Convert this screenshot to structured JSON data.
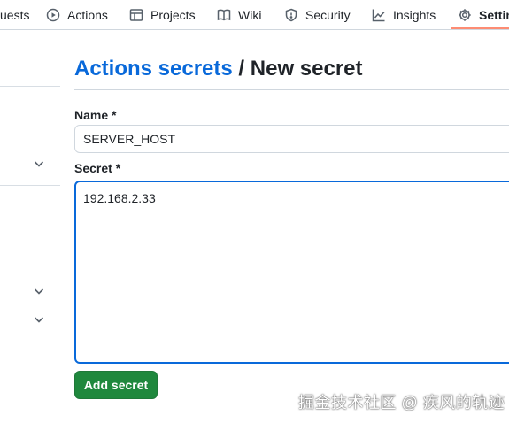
{
  "nav": {
    "tabs": [
      {
        "label": "uests",
        "icon": "pull-request-icon"
      },
      {
        "label": "Actions",
        "icon": "play-icon"
      },
      {
        "label": "Projects",
        "icon": "table-icon"
      },
      {
        "label": "Wiki",
        "icon": "book-icon"
      },
      {
        "label": "Security",
        "icon": "shield-icon"
      },
      {
        "label": "Insights",
        "icon": "graph-icon"
      },
      {
        "label": "Settin",
        "icon": "gear-icon",
        "selected": true
      }
    ]
  },
  "heading": {
    "breadcrumb": "Actions secrets",
    "separator": "/",
    "current": "New secret"
  },
  "form": {
    "name_label": "Name *",
    "name_value": "SERVER_HOST",
    "secret_label": "Secret *",
    "secret_value": "192.168.2.33",
    "submit_label": "Add secret"
  },
  "watermark": "掘金技术社区 @ 疾风的轨迹",
  "colors": {
    "link": "#0969da",
    "primary_button": "#1f883d",
    "focus_border": "#0969da",
    "tab_underline": "#fd8c73"
  }
}
